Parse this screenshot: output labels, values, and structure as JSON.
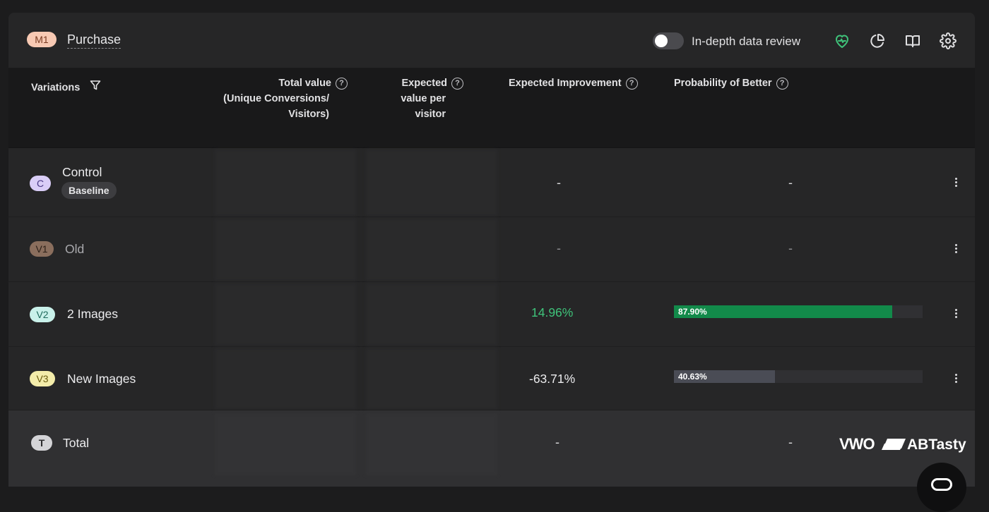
{
  "header": {
    "metric_badge": "M1",
    "metric_name": "Purchase",
    "toggle_label": "In-depth data review",
    "toggle_on": false,
    "icons": [
      "heart-pulse-icon",
      "pie-chart-icon",
      "book-open-icon",
      "gear-icon"
    ]
  },
  "columns": {
    "variations": "Variations",
    "total_value_line1": "Total value",
    "total_value_line2": "(Unique Conversions/",
    "total_value_line3": "Visitors)",
    "expected_value_line1": "Expected",
    "expected_value_line2": "value per",
    "expected_value_line3": "visitor",
    "expected_improvement": "Expected Improvement",
    "probability_of_better": "Probability of Better",
    "help_glyph": "?"
  },
  "rows": [
    {
      "badge": "C",
      "name": "Control",
      "tag": "Baseline",
      "improvement": "-",
      "probability": "-",
      "badge_bg": "#d9cdf7",
      "badge_fg": "#4b3a86"
    },
    {
      "badge": "V1",
      "name": "Old",
      "improvement": "-",
      "probability": "-",
      "badge_bg": "#8a6e5d",
      "badge_fg": "#2c1f17"
    },
    {
      "badge": "V2",
      "name": "2 Images",
      "improvement": "14.96%",
      "probability": "87.90%",
      "probability_value": 0.879,
      "improvement_color": "#3fc37a",
      "bar_color": "#128a4a",
      "badge_bg": "#c9f1ea",
      "badge_fg": "#1f6a5c"
    },
    {
      "badge": "V3",
      "name": "New Images",
      "improvement": "-63.71%",
      "probability": "40.63%",
      "probability_value": 0.4063,
      "improvement_color": "#ececee",
      "bar_color": "#4a4c55",
      "badge_bg": "#f3ecaa",
      "badge_fg": "#6b5d10"
    }
  ],
  "total": {
    "badge": "T",
    "name": "Total",
    "improvement": "-",
    "probability": "-"
  },
  "watermark": {
    "left": "VWO",
    "right": "ABTasty"
  },
  "colors": {
    "accent_green": "#3fc37a",
    "panel": "#262627",
    "header": "#19191a"
  }
}
